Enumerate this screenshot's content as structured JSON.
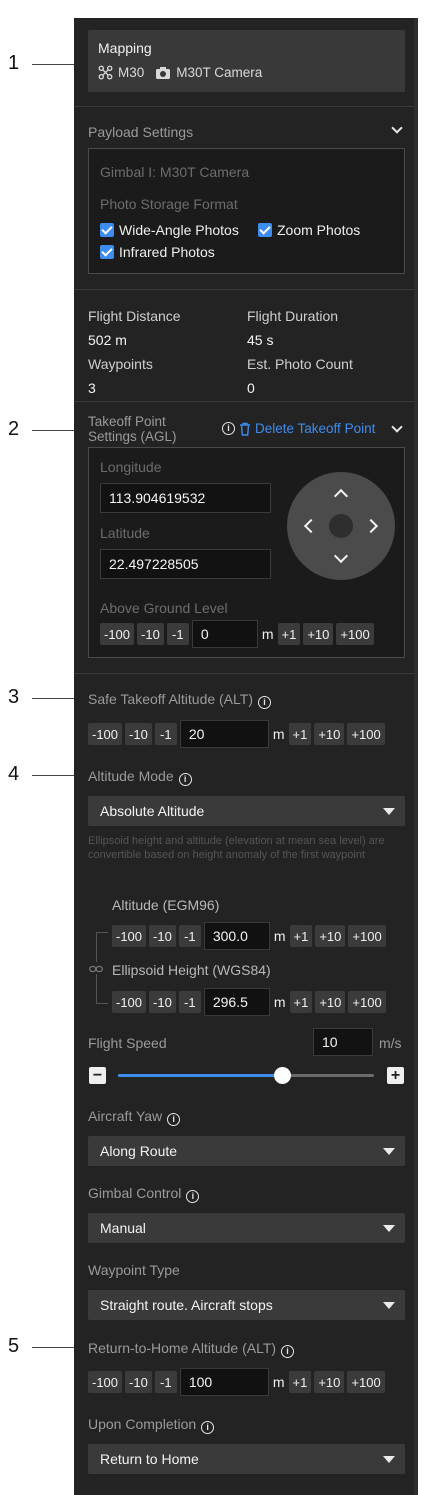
{
  "callouts": [
    "1",
    "2",
    "3",
    "4",
    "5"
  ],
  "mission": {
    "title": "Mapping",
    "drone_icon": "drone-icon",
    "drone": "M30",
    "camera_icon": "camera-icon",
    "camera": "M30T Camera"
  },
  "payload": {
    "section_label": "Payload Settings",
    "gimbal": "Gimbal I: M30T Camera",
    "format_label": "Photo Storage Format",
    "wide": "Wide-Angle Photos",
    "zoom": "Zoom Photos",
    "infrared": "Infrared Photos"
  },
  "stats": {
    "distance_label": "Flight Distance",
    "distance": "502 m",
    "duration_label": "Flight Duration",
    "duration": "45 s",
    "waypoints_label": "Waypoints",
    "waypoints": "3",
    "photos_label": "Est. Photo Count",
    "photos": "0"
  },
  "takeoff": {
    "label_line1": "Takeoff Point",
    "label_line2": "Settings (AGL)",
    "delete_label": "Delete Takeoff Point",
    "longitude_label": "Longitude",
    "longitude": "113.904619532",
    "latitude_label": "Latitude",
    "latitude": "22.497228505",
    "agl_label": "Above Ground Level",
    "agl": "0"
  },
  "steps": {
    "m100": "-100",
    "m10": "-10",
    "m1": "-1",
    "p1": "+1",
    "p10": "+10",
    "p100": "+100",
    "unit": "m"
  },
  "safe_takeoff": {
    "label": "Safe Takeoff Altitude (ALT)",
    "value": "20"
  },
  "altitude_mode": {
    "label": "Altitude Mode",
    "selected": "Absolute Altitude",
    "note": "Ellipsoid height and altitude (elevation at mean sea level) are convertible based on height anomaly of the first waypoint",
    "egm_label": "Altitude (EGM96)",
    "egm_value": "300.0",
    "wgs_label": "Ellipsoid Height (WGS84)",
    "wgs_value": "296.5"
  },
  "speed": {
    "label": "Flight Speed",
    "value": "10",
    "unit": "m/s",
    "minus": "−",
    "plus": "+",
    "level_fraction": 0.64
  },
  "yaw": {
    "label": "Aircraft Yaw",
    "selected": "Along Route"
  },
  "gimbal_control": {
    "label": "Gimbal Control",
    "selected": "Manual"
  },
  "waypoint_type": {
    "label": "Waypoint Type",
    "selected": "Straight route. Aircraft stops"
  },
  "rth": {
    "label": "Return-to-Home Altitude (ALT)",
    "value": "100"
  },
  "completion": {
    "label": "Upon Completion",
    "selected": "Return to Home"
  },
  "info_glyph": "i",
  "colors": {
    "panel": "#232323",
    "accent": "#3d8cf0",
    "card": "#393939"
  }
}
